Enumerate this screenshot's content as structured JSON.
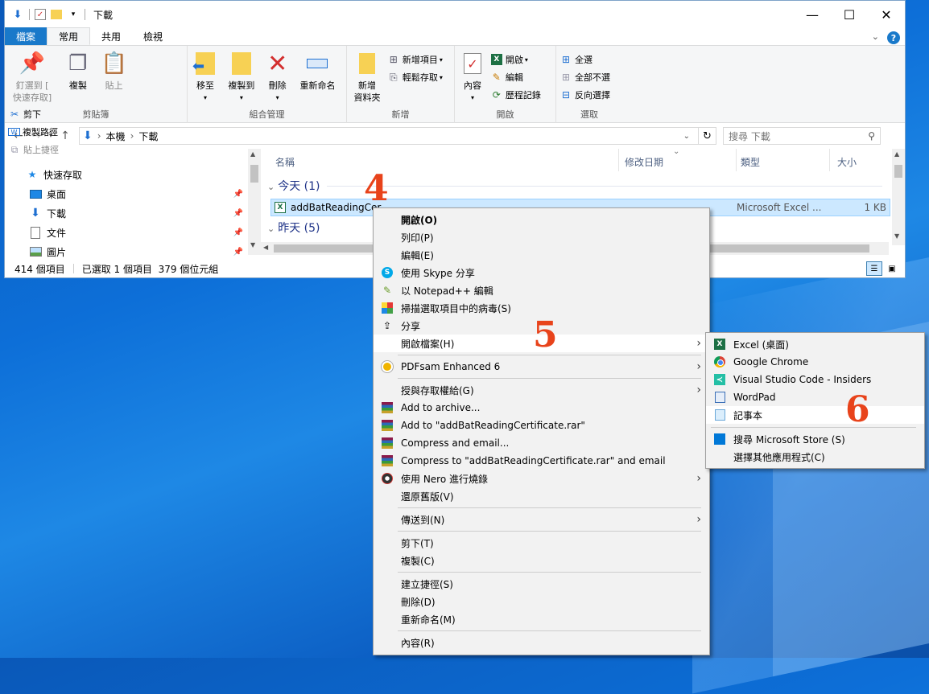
{
  "window": {
    "title": "下載",
    "controls": {
      "minimize": "—",
      "maximize": "☐",
      "close": "✕"
    }
  },
  "ribbon": {
    "tabs": [
      "檔案",
      "常用",
      "共用",
      "檢視"
    ],
    "clipboard": {
      "label": "剪貼簿",
      "pin_line1": "釘選到 [",
      "pin_line2": "快速存取]",
      "copy": "複製",
      "paste": "貼上",
      "cut": "剪下",
      "copy_path": "複製路徑",
      "paste_shortcut": "貼上捷徑"
    },
    "organize": {
      "label": "組合管理",
      "move_to": "移至",
      "copy_to": "複製到",
      "delete": "刪除",
      "rename": "重新命名"
    },
    "new": {
      "label": "新增",
      "new_folder_line1": "新增",
      "new_folder_line2": "資料夾",
      "new_item": "新增項目",
      "easy_access": "輕鬆存取"
    },
    "open": {
      "label": "開啟",
      "properties": "內容",
      "open": "開啟",
      "edit": "編輯",
      "history": "歷程記錄"
    },
    "select": {
      "label": "選取",
      "select_all": "全選",
      "select_none": "全部不選",
      "invert": "反向選擇"
    }
  },
  "address": {
    "path": [
      "本機",
      "下載"
    ],
    "search_placeholder": "搜尋 下載"
  },
  "nav": {
    "items": [
      {
        "label": "快速存取",
        "icon": "star-icon"
      },
      {
        "label": "桌面",
        "icon": "desktop-icon"
      },
      {
        "label": "下載",
        "icon": "download-icon"
      },
      {
        "label": "文件",
        "icon": "document-icon"
      },
      {
        "label": "圖片",
        "icon": "picture-icon"
      }
    ]
  },
  "files": {
    "columns": {
      "name": "名稱",
      "modified": "修改日期",
      "type": "類型",
      "size": "大小"
    },
    "group_today": "今天 (1)",
    "group_yesterday": "昨天 (5)",
    "selected_file": {
      "name": "addBatReadingCer",
      "type": "Microsoft Excel ...",
      "size": "1 KB"
    }
  },
  "status": {
    "count": "414 個項目",
    "selection": "已選取 1 個項目  379 個位元組"
  },
  "context_menu": {
    "items": [
      {
        "label": "開啟(O)"
      },
      {
        "label": "列印(P)"
      },
      {
        "label": "編輯(E)"
      },
      {
        "label": "使用 Skype 分享",
        "icon": "skype-icon"
      },
      {
        "label": "以 Notepad++ 編輯",
        "icon": "notepadpp-icon"
      },
      {
        "label": "掃描選取項目中的病毒(S)",
        "icon": "antivirus-icon"
      },
      {
        "label": "分享",
        "icon": "share-icon"
      },
      {
        "label": "開啟檔案(H)",
        "submenu": true
      },
      {
        "label": "PDFsam Enhanced 6",
        "icon": "pdfsam-icon",
        "submenu": true
      },
      {
        "label": "授與存取權給(G)",
        "submenu": true
      },
      {
        "label": "Add to archive...",
        "icon": "winrar-icon"
      },
      {
        "label": "Add to \"addBatReadingCertificate.rar\"",
        "icon": "winrar-icon"
      },
      {
        "label": "Compress and email...",
        "icon": "winrar-icon"
      },
      {
        "label": "Compress to \"addBatReadingCertificate.rar\" and email",
        "icon": "winrar-icon"
      },
      {
        "label": "使用 Nero 進行燒錄",
        "icon": "nero-icon",
        "submenu": true
      },
      {
        "label": "還原舊版(V)"
      },
      {
        "label": "傳送到(N)",
        "submenu": true
      },
      {
        "label": "剪下(T)"
      },
      {
        "label": "複製(C)"
      },
      {
        "label": "建立捷徑(S)"
      },
      {
        "label": "刪除(D)"
      },
      {
        "label": "重新命名(M)"
      },
      {
        "label": "內容(R)"
      }
    ]
  },
  "open_with_menu": {
    "items": [
      {
        "label": "Excel (桌面)",
        "icon": "excel-icon"
      },
      {
        "label": "Google Chrome",
        "icon": "chrome-icon"
      },
      {
        "label": "Visual Studio Code - Insiders",
        "icon": "vscode-icon"
      },
      {
        "label": "WordPad",
        "icon": "wordpad-icon"
      },
      {
        "label": "記事本",
        "icon": "notepad-icon"
      },
      {
        "label": "搜尋 Microsoft Store (S)",
        "icon": "store-icon"
      },
      {
        "label": "選擇其他應用程式(C)"
      }
    ]
  },
  "annotations": {
    "step4": "4",
    "step5": "5",
    "step6": "6"
  },
  "colors": {
    "accent": "#1979ca",
    "annotation": "#e8431b",
    "selection": "#cce8ff"
  }
}
